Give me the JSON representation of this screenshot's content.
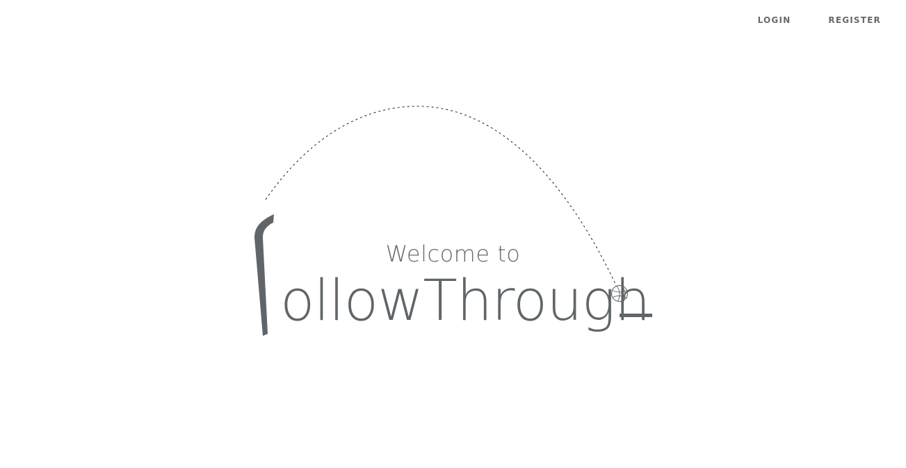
{
  "nav": {
    "login_label": "LOGIN",
    "register_label": "REGISTER"
  },
  "hero": {
    "welcome_text": "Welcome to",
    "brand_text": "ollowThrough"
  },
  "icons": {
    "ball": "basketball-icon",
    "hoop_arm": "f-hook-stroke",
    "rim": "rim-stroke"
  },
  "colors": {
    "text": "#646a6c",
    "brand": "#5f6568",
    "background": "#ffffff"
  }
}
